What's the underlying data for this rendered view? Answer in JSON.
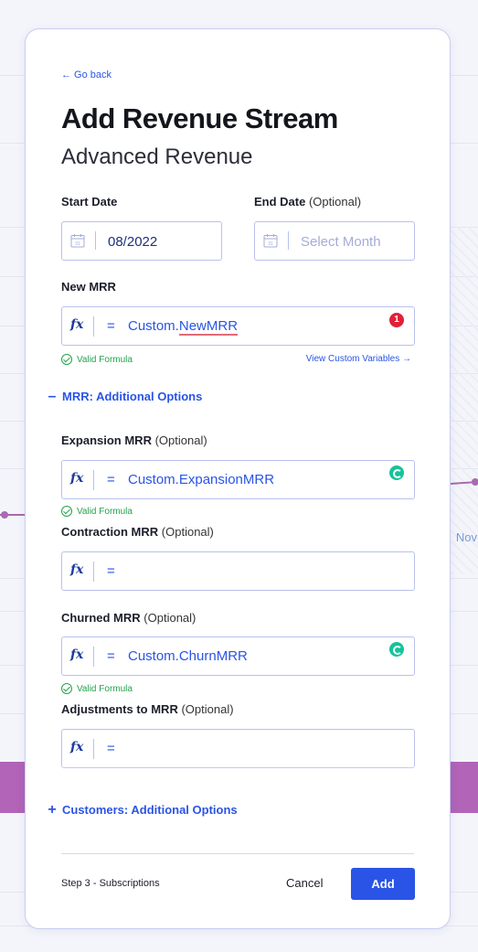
{
  "background": {
    "axis_label": "Nov"
  },
  "modal": {
    "go_back": "← Go back",
    "title": "Add Revenue Stream",
    "subtitle": "Advanced Revenue",
    "start_date": {
      "label": "Start Date",
      "value": "08/2022",
      "icon": "calendar-icon"
    },
    "end_date": {
      "label": "End Date",
      "optional": "(Optional)",
      "placeholder": "Select Month",
      "icon": "calendar-icon"
    },
    "new_mrr": {
      "label": "New MRR",
      "eq": "=",
      "prefix": "Custom.",
      "var": "NewMRR",
      "error_count": "1",
      "valid": "Valid Formula",
      "view_vars": "View Custom Variables →"
    },
    "mrr_options": {
      "symbol": "–",
      "label": "MRR: Additional Options"
    },
    "expansion": {
      "label": "Expansion MRR",
      "optional": "(Optional)",
      "eq": "=",
      "value": "Custom.ExpansionMRR",
      "valid": "Valid Formula"
    },
    "contraction": {
      "label": "Contraction MRR",
      "optional": "(Optional)",
      "eq": "=",
      "value": ""
    },
    "churned": {
      "label": "Churned MRR",
      "optional": "(Optional)",
      "eq": "=",
      "value": "Custom.ChurnMRR",
      "valid": "Valid Formula"
    },
    "adjustments": {
      "label": "Adjustments to MRR",
      "optional": "(Optional)",
      "eq": "=",
      "value": ""
    },
    "customers_options": {
      "symbol": "+",
      "label": "Customers: Additional Options"
    },
    "footer": {
      "step": "Step 3 - Subscriptions",
      "cancel": "Cancel",
      "add": "Add"
    },
    "fx_symbol": "fx"
  },
  "colors": {
    "accent": "#2a54e6",
    "error": "#e0213a",
    "valid": "#23a34a",
    "grammarly": "#15c39a",
    "bg_band": "#b164b8"
  }
}
